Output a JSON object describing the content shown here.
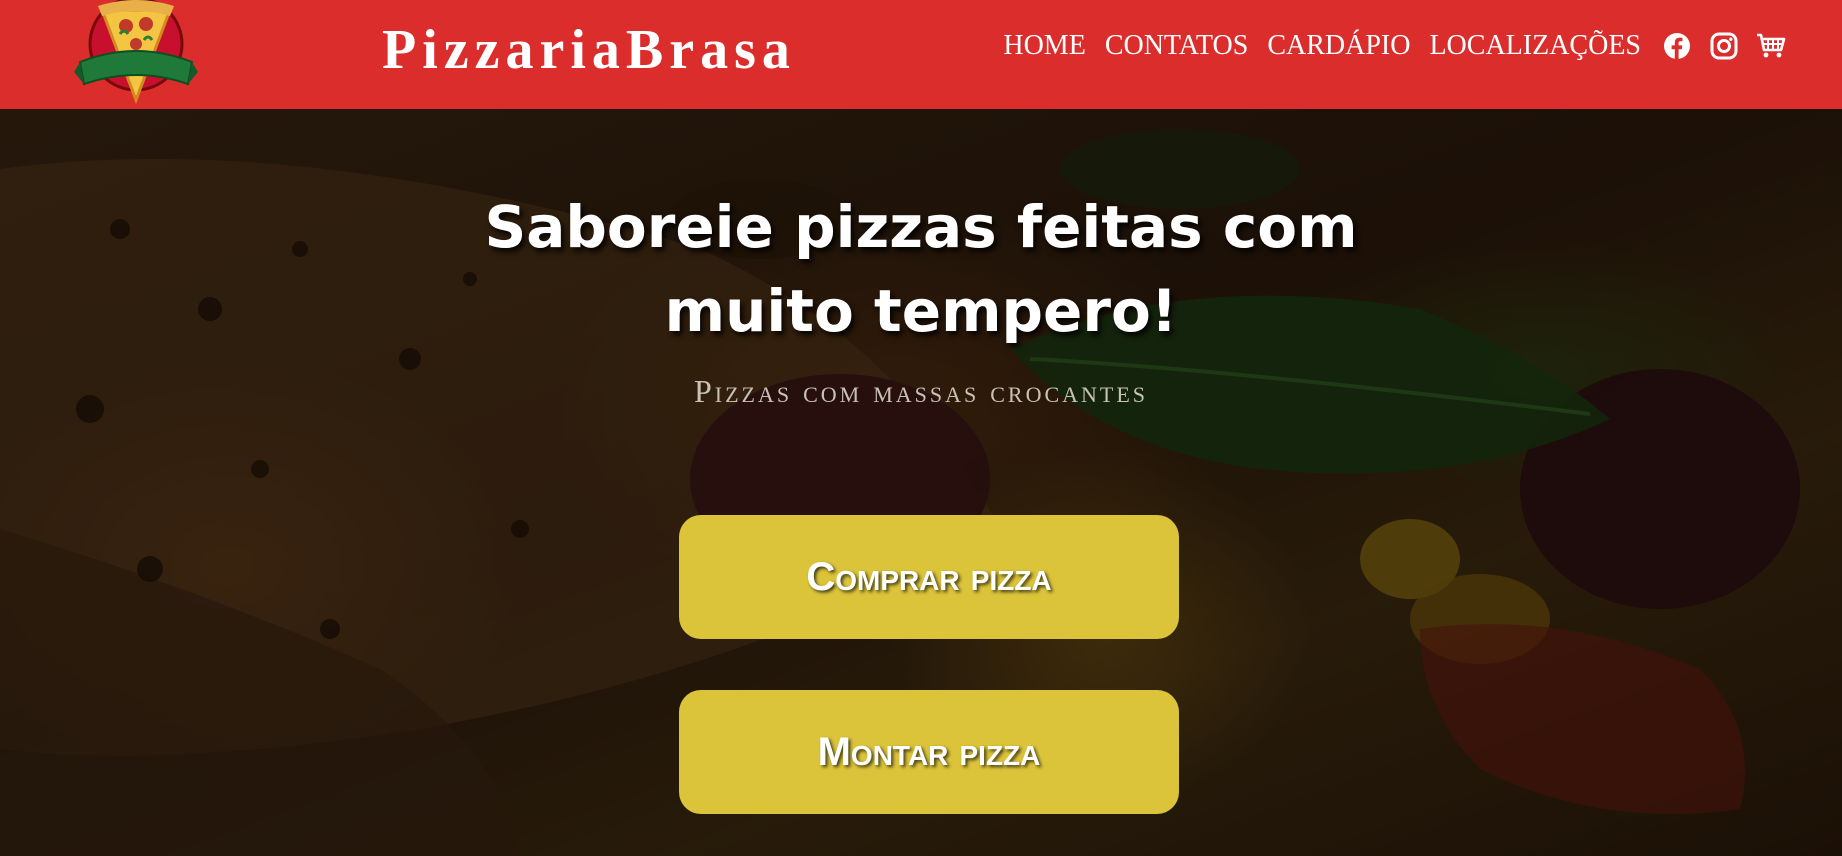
{
  "header": {
    "brand": "PizzariaBrasa",
    "logo_icon": "pizza-slice-logo-icon",
    "background_color": "#dc2d2d",
    "nav": [
      {
        "label": "HOME"
      },
      {
        "label": "CONTATOS"
      },
      {
        "label": "CARDÁPIO"
      },
      {
        "label": "LOCALIZAÇÕES"
      }
    ],
    "icons": [
      "facebook-icon",
      "instagram-icon",
      "cart-icon"
    ]
  },
  "hero": {
    "title": "Saboreie pizzas feitas com muito tempero!",
    "subtitle": "Pizzas com massas crocantes",
    "buttons": {
      "buy": "Comprar pizza",
      "build": "Montar pizza"
    },
    "button_color": "#dbc33a"
  }
}
